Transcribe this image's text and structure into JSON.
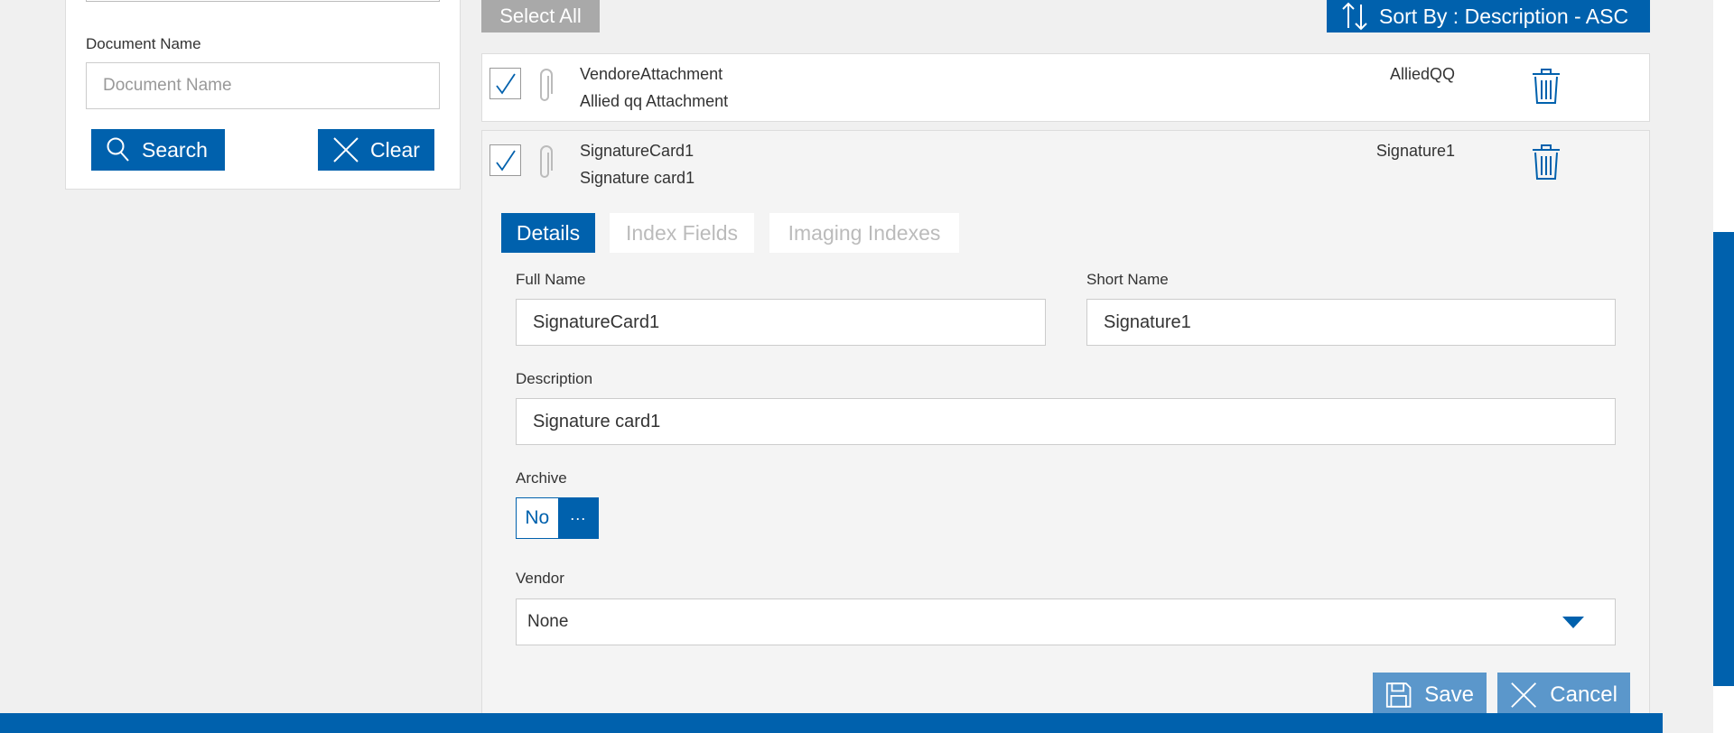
{
  "colors": {
    "primary": "#0061ad",
    "disabled_button": "#a9a9a9",
    "action_button": "#5b97cb",
    "page_bg": "#f0f0f0"
  },
  "search_panel": {
    "document_name_label": "Document Name",
    "document_name_placeholder": "Document Name",
    "search_label": "Search",
    "search_icon": "magnifier-icon",
    "clear_label": "Clear",
    "clear_icon": "x-icon"
  },
  "toolbar": {
    "select_all_label": "Select All",
    "sort_label": "Sort By : Description - ASC",
    "sort_icon": "sort-arrows-icon"
  },
  "documents": [
    {
      "title": "VendoreAttachment",
      "subtitle": "Allied qq Attachment",
      "short_name": "AlliedQQ",
      "checked": true
    },
    {
      "title": "SignatureCard1",
      "subtitle": "Signature card1",
      "short_name": "Signature1",
      "checked": true
    }
  ],
  "detail": {
    "tabs": [
      {
        "label": "Details",
        "active": true
      },
      {
        "label": "Index Fields",
        "active": false
      },
      {
        "label": "Imaging Indexes",
        "active": false
      }
    ],
    "full_name_label": "Full Name",
    "full_name_value": "SignatureCard1",
    "short_name_label": "Short Name",
    "short_name_value": "Signature1",
    "description_label": "Description",
    "description_value": "Signature card1",
    "archive_label": "Archive",
    "archive_value": "No",
    "archive_more": "···",
    "vendor_label": "Vendor",
    "vendor_value": "None",
    "save_label": "Save",
    "cancel_label": "Cancel"
  }
}
